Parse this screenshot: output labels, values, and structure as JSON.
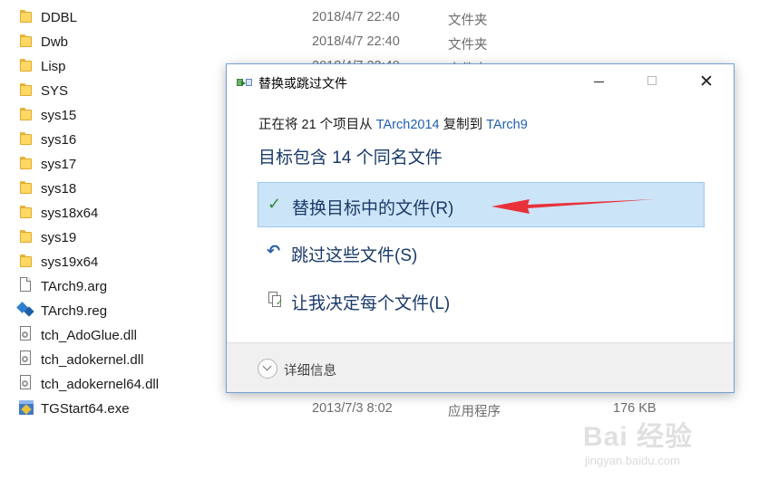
{
  "explorer": {
    "files": [
      {
        "name": "DDBL",
        "date": "2018/4/7 22:40",
        "type": "文件夹",
        "size": "",
        "icon": "folder-icon"
      },
      {
        "name": "Dwb",
        "date": "2018/4/7 22:40",
        "type": "文件夹",
        "size": "",
        "icon": "folder-icon"
      },
      {
        "name": "Lisp",
        "date": "2018/4/7 22:40",
        "type": "文件夹",
        "size": "",
        "icon": "folder-icon"
      },
      {
        "name": "SYS",
        "date": "",
        "type": "",
        "size": "",
        "icon": "folder-icon"
      },
      {
        "name": "sys15",
        "date": "",
        "type": "",
        "size": "",
        "icon": "folder-icon"
      },
      {
        "name": "sys16",
        "date": "",
        "type": "",
        "size": "",
        "icon": "folder-icon"
      },
      {
        "name": "sys17",
        "date": "",
        "type": "",
        "size": "",
        "icon": "folder-icon"
      },
      {
        "name": "sys18",
        "date": "",
        "type": "",
        "size": "",
        "icon": "folder-icon"
      },
      {
        "name": "sys18x64",
        "date": "",
        "type": "",
        "size": "",
        "icon": "folder-icon"
      },
      {
        "name": "sys19",
        "date": "",
        "type": "",
        "size": "",
        "icon": "folder-icon"
      },
      {
        "name": "sys19x64",
        "date": "",
        "type": "",
        "size": "",
        "icon": "folder-icon"
      },
      {
        "name": "TArch9.arg",
        "date": "",
        "type": "",
        "size": "",
        "icon": "document-icon"
      },
      {
        "name": "TArch9.reg",
        "date": "",
        "type": "",
        "size": "",
        "icon": "registry-icon"
      },
      {
        "name": "tch_AdoGlue.dll",
        "date": "",
        "type": "",
        "size": "",
        "icon": "dll-icon"
      },
      {
        "name": "tch_adokernel.dll",
        "date": "",
        "type": "",
        "size": "",
        "icon": "dll-icon"
      },
      {
        "name": "tch_adokernel64.dll",
        "date": "",
        "type": "",
        "size": "",
        "icon": "dll-icon"
      },
      {
        "name": "TGStart64.exe",
        "date": "2013/7/3 8:02",
        "type": "应用程序",
        "size": "176 KB",
        "icon": "exe-icon"
      }
    ]
  },
  "dialog": {
    "title": "替换或跳过文件",
    "progress": {
      "prefix": "正在将 21 个项目从 ",
      "source": "TArch2014",
      "middle": " 复制到 ",
      "destination": "TArch9"
    },
    "headline": "目标包含 14 个同名文件",
    "options": {
      "replace": "替换目标中的文件(R)",
      "skip": "跳过这些文件(S)",
      "decide": "让我决定每个文件(L)"
    },
    "details_label": "详细信息",
    "close_glyph": "✕"
  },
  "icons": {
    "check": "✓",
    "undo": "↶",
    "small_check": "✓"
  },
  "watermark": {
    "brand": "Bai 经验",
    "url": "jingyan.baidu.com"
  },
  "colors": {
    "accent": "#2060b0",
    "selected_option": "#cce4f7",
    "annotation_arrow": "#e8323a"
  }
}
